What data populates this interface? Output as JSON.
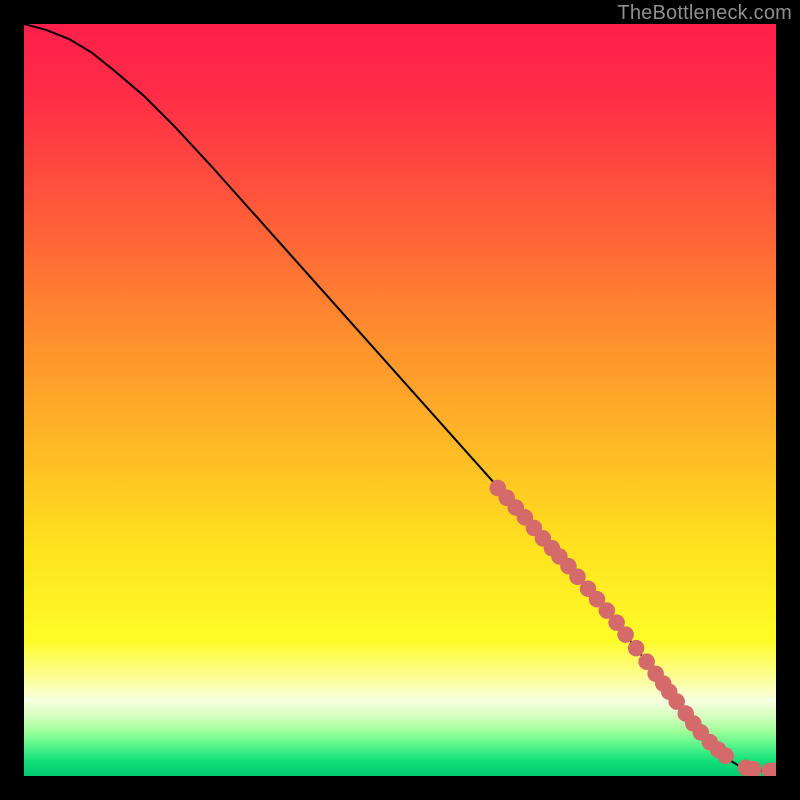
{
  "watermark": "TheBottleneck.com",
  "colors": {
    "frame": "#010101",
    "line": "#000000",
    "marker_fill": "#d46a6a",
    "marker_stroke": "#d46a6a",
    "gradient_stops": [
      {
        "offset": 0.0,
        "color": "#ff1f4b"
      },
      {
        "offset": 0.1,
        "color": "#ff2e46"
      },
      {
        "offset": 0.25,
        "color": "#ff5a3a"
      },
      {
        "offset": 0.4,
        "color": "#ff8a2f"
      },
      {
        "offset": 0.55,
        "color": "#ffb626"
      },
      {
        "offset": 0.7,
        "color": "#ffe31e"
      },
      {
        "offset": 0.82,
        "color": "#fffc2a"
      },
      {
        "offset": 0.88,
        "color": "#fbffb0"
      },
      {
        "offset": 0.9,
        "color": "#f5ffe0"
      },
      {
        "offset": 0.92,
        "color": "#d7ffbf"
      },
      {
        "offset": 0.94,
        "color": "#9fff9a"
      },
      {
        "offset": 0.96,
        "color": "#57f58a"
      },
      {
        "offset": 0.98,
        "color": "#12df7c"
      },
      {
        "offset": 1.0,
        "color": "#00c96e"
      }
    ]
  },
  "chart_data": {
    "type": "line",
    "title": "",
    "xlabel": "",
    "ylabel": "",
    "xlim": [
      0,
      100
    ],
    "ylim": [
      0,
      100
    ],
    "series": [
      {
        "name": "curve",
        "x": [
          0,
          3,
          6,
          9,
          12,
          16,
          20,
          25,
          30,
          35,
          40,
          45,
          50,
          55,
          60,
          65,
          70,
          75,
          80,
          85,
          88,
          91,
          93,
          95,
          97,
          99,
          100
        ],
        "y": [
          100,
          99.2,
          98.0,
          96.2,
          93.8,
          90.4,
          86.4,
          81.0,
          75.4,
          69.8,
          64.2,
          58.6,
          53.0,
          47.4,
          41.8,
          36.2,
          30.6,
          24.8,
          18.8,
          12.3,
          8.3,
          4.6,
          2.6,
          1.4,
          0.8,
          0.6,
          0.6
        ]
      }
    ],
    "markers": {
      "name": "points",
      "r": 1.1,
      "x": [
        63.0,
        64.2,
        65.4,
        66.6,
        67.8,
        69.0,
        70.2,
        71.2,
        72.4,
        73.6,
        75.0,
        76.2,
        77.5,
        78.8,
        80.0,
        81.4,
        82.8,
        84.0,
        85.0,
        85.8,
        86.8,
        88.0,
        89.0,
        90.0,
        91.2,
        92.3,
        93.3,
        96.0,
        97.0,
        99.2,
        100.0
      ],
      "y": [
        38.3,
        37.0,
        35.7,
        34.4,
        33.0,
        31.6,
        30.3,
        29.2,
        27.9,
        26.5,
        24.9,
        23.5,
        22.0,
        20.4,
        18.8,
        17.0,
        15.2,
        13.6,
        12.3,
        11.2,
        9.9,
        8.3,
        7.0,
        5.8,
        4.5,
        3.5,
        2.7,
        1.1,
        0.9,
        0.7,
        0.7
      ]
    }
  }
}
